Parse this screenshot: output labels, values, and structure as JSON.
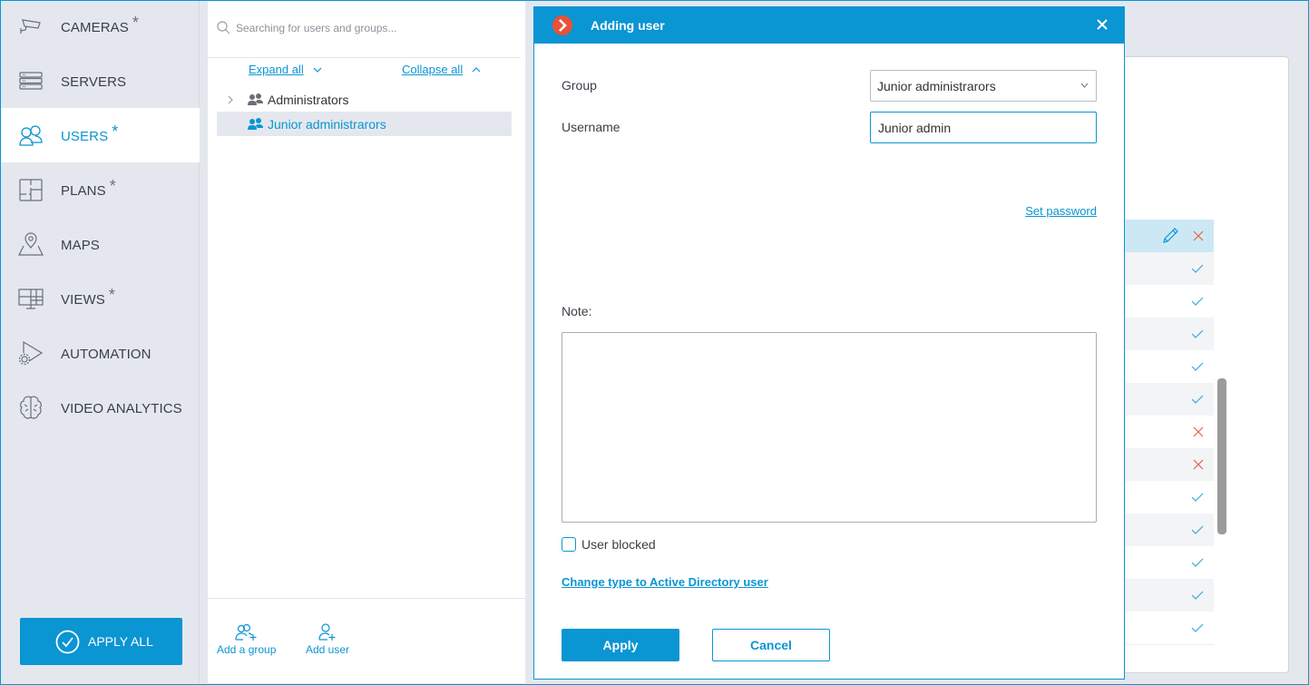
{
  "colors": {
    "accent": "#0a95d3",
    "sidebar_bg": "#e4e8ee",
    "error": "#e8604c",
    "logo": "#e8513a"
  },
  "sidebar": {
    "items": [
      {
        "label": "CAMERAS",
        "icon": "camera-icon",
        "modified": true,
        "star": "*",
        "active": false
      },
      {
        "label": "SERVERS",
        "icon": "server-icon",
        "modified": false,
        "star": "",
        "active": false
      },
      {
        "label": "USERS",
        "icon": "users-icon",
        "modified": true,
        "star": "*",
        "active": true
      },
      {
        "label": "PLANS",
        "icon": "plan-icon",
        "modified": true,
        "star": "*",
        "active": false
      },
      {
        "label": "MAPS",
        "icon": "map-pin-icon",
        "modified": false,
        "star": "",
        "active": false
      },
      {
        "label": "VIEWS",
        "icon": "monitor-grid-icon",
        "modified": true,
        "star": "*",
        "active": false
      },
      {
        "label": "AUTOMATION",
        "icon": "automation-gear-icon",
        "modified": false,
        "star": "",
        "active": false
      },
      {
        "label": "VIDEO ANALYTICS",
        "icon": "brain-icon",
        "modified": false,
        "star": "",
        "active": false
      }
    ],
    "apply_all_label": "APPLY ALL"
  },
  "tree": {
    "search_placeholder": "Searching for users and groups...",
    "expand_all": "Expand all",
    "collapse_all": "Collapse all",
    "groups": [
      {
        "label": "Administrators",
        "expandable": true,
        "selected": false
      },
      {
        "label": "Junior administrarors",
        "expandable": false,
        "selected": true
      }
    ],
    "add_group_label": "Add a group",
    "add_user_label": "Add user"
  },
  "background_table": {
    "header_actions": [
      "edit",
      "delete"
    ],
    "rows": [
      "check",
      "check",
      "check",
      "check",
      "check",
      "cross",
      "cross",
      "check",
      "check",
      "check",
      "check",
      "check"
    ]
  },
  "dialog": {
    "title": "Adding user",
    "group_label": "Group",
    "group_value": "Junior administrarors",
    "username_label": "Username",
    "username_value": "Junior admin",
    "set_password": "Set password",
    "note_label": "Note:",
    "note_value": "",
    "user_blocked_label": "User blocked",
    "user_blocked_checked": false,
    "change_type_link": "Change type to Active Directory user",
    "apply_label": "Apply",
    "cancel_label": "Cancel"
  }
}
